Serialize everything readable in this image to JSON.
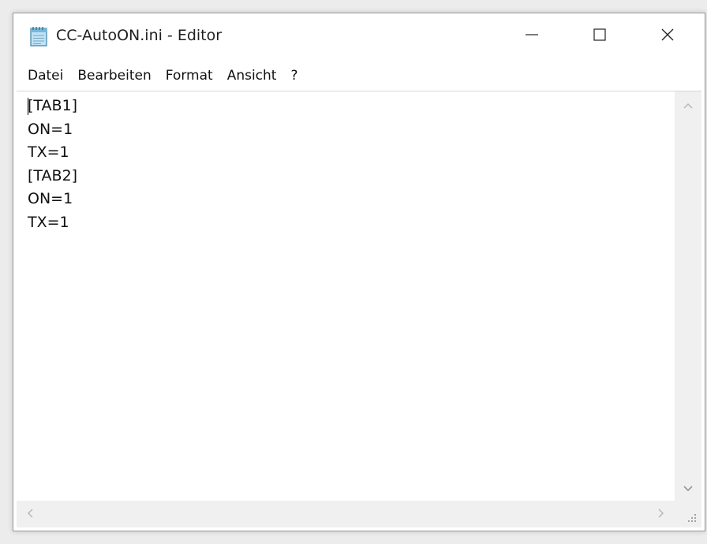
{
  "window": {
    "title": "CC-AutoON.ini - Editor",
    "icon": "notepad-icon",
    "controls": {
      "minimize_icon": "minimize-icon",
      "maximize_icon": "maximize-icon",
      "close_icon": "close-icon"
    }
  },
  "menu": {
    "items": [
      {
        "label": "Datei"
      },
      {
        "label": "Bearbeiten"
      },
      {
        "label": "Format"
      },
      {
        "label": "Ansicht"
      },
      {
        "label": "?"
      }
    ]
  },
  "editor": {
    "text": "[TAB1]\nON=1\nTX=1\n[TAB2]\nON=1\nTX=1"
  },
  "colors": {
    "window_bg": "#ffffff",
    "scrollbar_bg": "#f0f0f0",
    "arrow": "#b8b8b8"
  }
}
